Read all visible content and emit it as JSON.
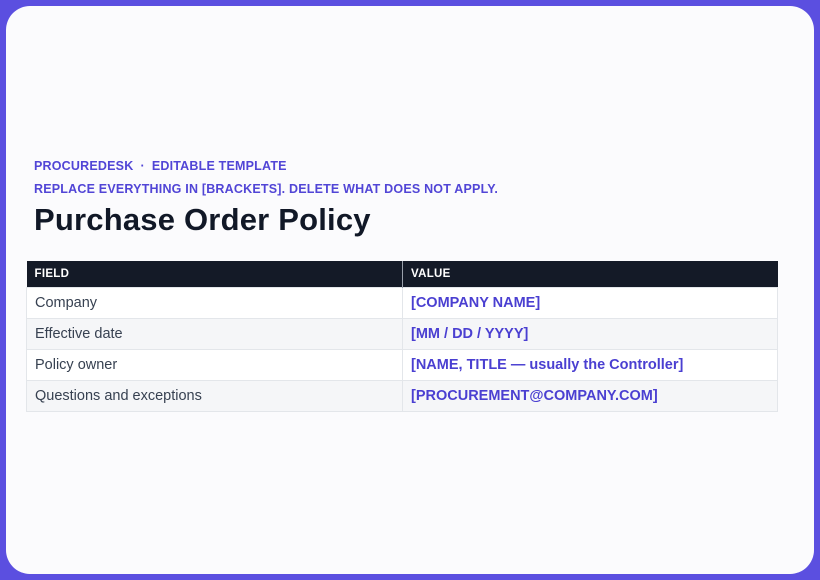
{
  "header": {
    "brand": "PROCUREDESK",
    "separator": "·",
    "doc_type": "EDITABLE TEMPLATE",
    "instruction": "REPLACE EVERYTHING IN [BRACKETS]. DELETE WHAT DOES NOT APPLY.",
    "title": "Purchase Order Policy"
  },
  "table": {
    "columns": [
      "FIELD",
      "VALUE"
    ],
    "rows": [
      {
        "field": "Company",
        "value": "[COMPANY NAME]"
      },
      {
        "field": "Effective date",
        "value": "[MM / DD / YYYY]"
      },
      {
        "field": "Policy owner",
        "value": "[NAME, TITLE — usually the Controller]"
      },
      {
        "field": "Questions and exceptions",
        "value": "[PROCUREMENT@COMPANY.COM]"
      }
    ]
  },
  "colors": {
    "frame": "#5b4fe0",
    "accent": "#5145d6",
    "header_bg": "#141a27",
    "title": "#111827"
  }
}
